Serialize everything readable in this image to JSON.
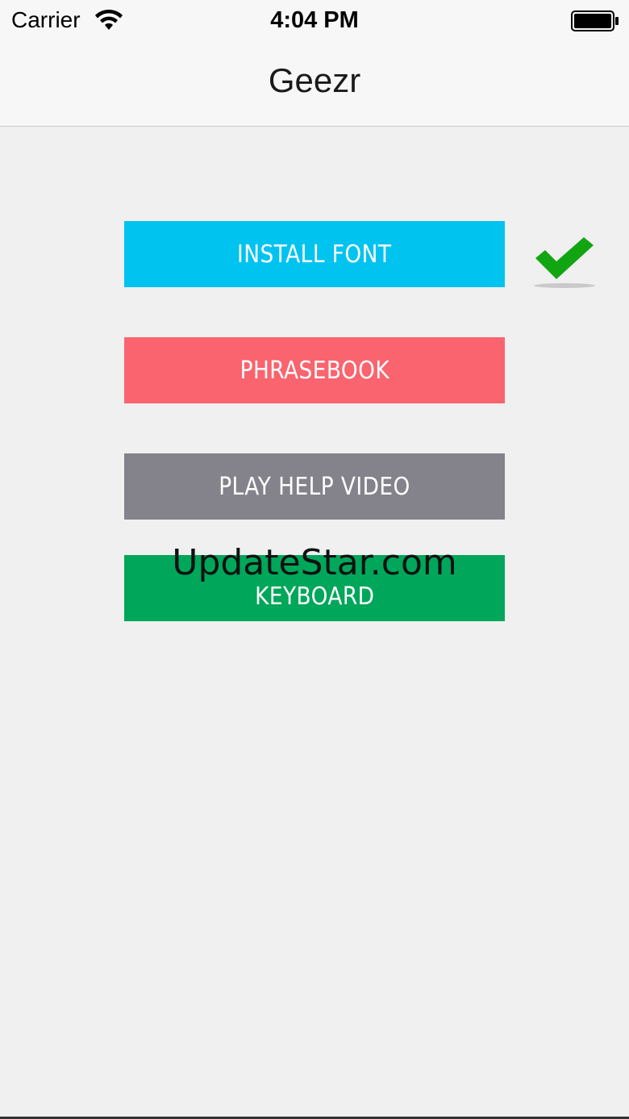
{
  "status_bar": {
    "carrier": "Carrier",
    "time": "4:04 PM",
    "wifi_icon": "wifi-icon",
    "battery_icon": "battery-icon"
  },
  "nav": {
    "title": "Geezr"
  },
  "buttons": {
    "install_font": "INSTALL FONT",
    "phrasebook": "PHRASEBOOK",
    "help_video": "PLAY HELP VIDEO",
    "keyboard": "KEYBOARD"
  },
  "install_status_icon": "checkmark-icon",
  "watermark": "UpdateStar.com",
  "colors": {
    "install": "#00c3f0",
    "phrasebook": "#f9646e",
    "video": "#84838b",
    "keyboard": "#00a65a",
    "check": "#12a512"
  }
}
